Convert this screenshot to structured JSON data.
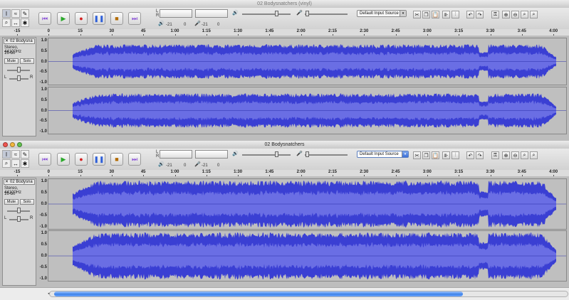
{
  "windows": [
    {
      "title": "02 Bodysnatchers (vinyl)",
      "active": false,
      "input_source": "Default Input Source",
      "track": {
        "name": "02 Bodysna",
        "format": "Stereo, 44100Hz",
        "bits": "16-bit",
        "mute": "Mute",
        "solo": "Solo",
        "pan_left": "L",
        "pan_right": "R"
      }
    },
    {
      "title": "02 Bodysnatchers",
      "active": true,
      "input_source": "Default Input Source",
      "track": {
        "name": "02 Bodysna",
        "format": "Stereo, 44100Hz",
        "bits": "16-bit",
        "mute": "Mute",
        "solo": "Solo",
        "pan_left": "L",
        "pan_right": "R"
      }
    }
  ],
  "toolbar": {
    "meter_left": "L",
    "meter_right": "R",
    "meter_value_a": "-21",
    "meter_value_b": "0",
    "meter_value_c": "-21",
    "meter_value_d": "0",
    "speaker_icon": "🔊",
    "mic_icon": "🎤"
  },
  "ruler": [
    "-15",
    "0",
    "15",
    "30",
    "45",
    "1:00",
    "1:15",
    "1:30",
    "1:45",
    "2:00",
    "2:15",
    "2:30",
    "2:45",
    "3:00",
    "3:15",
    "3:30",
    "3:45",
    "4:00"
  ],
  "scale": [
    "1.0",
    "0.5",
    "0.0",
    "-0.5",
    "-1.0"
  ],
  "colors": {
    "waveform": "#3a3fd3",
    "waveform_rms": "#6a6ee4",
    "track_bg": "#bfbfbf",
    "scrollbar": "#3f83e9"
  }
}
